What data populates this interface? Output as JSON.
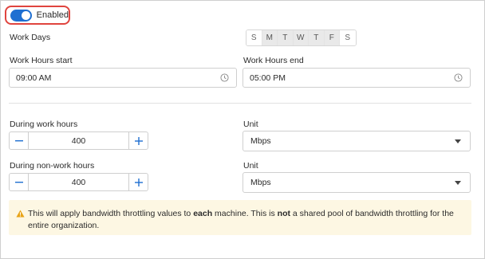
{
  "toggle": {
    "label": "Enabled",
    "on": true
  },
  "work_days": {
    "label": "Work Days",
    "days": [
      {
        "letter": "S",
        "selected": false
      },
      {
        "letter": "M",
        "selected": true
      },
      {
        "letter": "T",
        "selected": true
      },
      {
        "letter": "W",
        "selected": true
      },
      {
        "letter": "T",
        "selected": true
      },
      {
        "letter": "F",
        "selected": true
      },
      {
        "letter": "S",
        "selected": false
      }
    ]
  },
  "hours": {
    "start_label": "Work Hours start",
    "start_value": "09:00 AM",
    "end_label": "Work Hours end",
    "end_value": "05:00 PM"
  },
  "work_hours": {
    "label": "During work hours",
    "value": "400",
    "unit_label": "Unit",
    "unit_value": "Mbps"
  },
  "non_work_hours": {
    "label": "During non-work hours",
    "value": "400",
    "unit_label": "Unit",
    "unit_value": "Mbps"
  },
  "notice": {
    "part1": "This will apply bandwidth throttling values to ",
    "bold1": "each",
    "part2": " machine. This is ",
    "bold2": "not",
    "part3": " a shared pool of bandwidth throttling for the entire organization."
  },
  "colors": {
    "accent": "#1f6fd1",
    "highlight_border": "#e0443e",
    "notice_bg": "#fdf7e3",
    "warning": "#e8a317"
  }
}
